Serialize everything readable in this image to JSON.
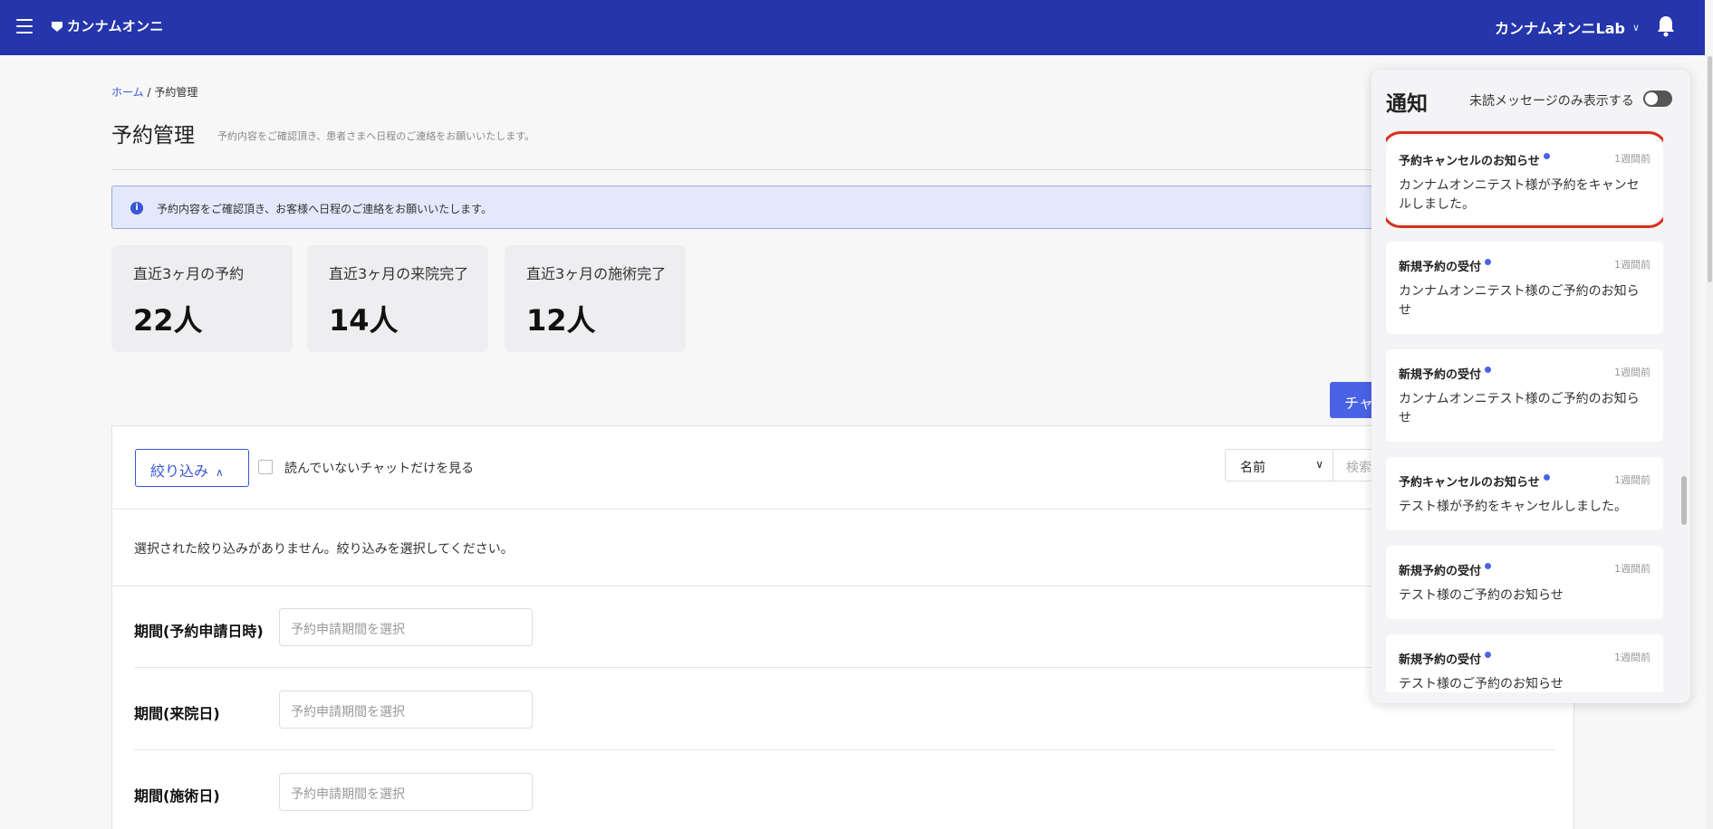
{
  "header": {
    "app_name": "カンナムオンニ",
    "account_name": "カンナムオンニLab",
    "account_chevron": "∨"
  },
  "breadcrumb": {
    "home": "ホーム",
    "separator": "/",
    "current": "予約管理"
  },
  "page": {
    "title": "予約管理",
    "subtitle": "予約内容をご確認頂き、患者さまへ日程のご連絡をお願いいたします。"
  },
  "info_banner": {
    "icon_text": "i",
    "text": "予約内容をご確認頂き、お客様へ日程のご連絡をお願いいたします。"
  },
  "stats": [
    {
      "label": "直近3ヶ月の予約",
      "value": "22人"
    },
    {
      "label": "直近3ヶ月の来院完了",
      "value": "14人"
    },
    {
      "label": "直近3ヶ月の施術完了",
      "value": "12人"
    }
  ],
  "chat_button": "チャ",
  "filter": {
    "button_label": "絞り込み",
    "unread_label": "読んでいないチャットだけを見る",
    "search_field": "名前",
    "search_placeholder": "検索",
    "no_filter_message": "選択された絞り込みがありません。絞り込みを選択してください。"
  },
  "periods": [
    {
      "label": "期間(予約申請日時)",
      "placeholder": "予約申請期間を選択"
    },
    {
      "label": "期間(来院日)",
      "placeholder": "予約申請期間を選択"
    },
    {
      "label": "期間(施術日)",
      "placeholder": "予約申請期間を選択"
    }
  ],
  "notifications": {
    "title": "通知",
    "toggle_label": "未読メッセージのみ表示する",
    "toggle_on": false,
    "items": [
      {
        "title": "予約キャンセルのお知らせ",
        "time": "1週間前",
        "body": "カンナムオンニテスト様が予約をキャンセルしました。",
        "unread": true,
        "highlighted": true
      },
      {
        "title": "新規予約の受付",
        "time": "1週間前",
        "body": "カンナムオンニテスト様のご予約のお知らせ",
        "unread": true
      },
      {
        "title": "新規予約の受付",
        "time": "1週間前",
        "body": "カンナムオンニテスト様のご予約のお知らせ",
        "unread": true
      },
      {
        "title": "予約キャンセルのお知らせ",
        "time": "1週間前",
        "body": "テスト様が予約をキャンセルしました。",
        "unread": true
      },
      {
        "title": "新規予約の受付",
        "time": "1週間前",
        "body": "テスト様のご予約のお知らせ",
        "unread": true
      },
      {
        "title": "新規予約の受付",
        "time": "1週間前",
        "body": "テスト様のご予約のお知らせ",
        "unread": true
      }
    ]
  },
  "colors": {
    "header_bg": "#2535ab",
    "accent": "#3a55d8",
    "highlight_outline": "#d8301e",
    "unread_dot": "#4a63e6"
  }
}
